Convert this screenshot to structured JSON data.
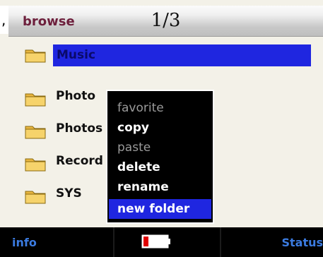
{
  "header": {
    "title": "browse",
    "page_indicator": "1/3",
    "stray_mark": ","
  },
  "folders": [
    {
      "label": "Music",
      "selected": true
    },
    {
      "label": "Photo",
      "selected": false
    },
    {
      "label": "Photos",
      "selected": false
    },
    {
      "label": "Record",
      "selected": false
    },
    {
      "label": "SYS",
      "selected": false
    }
  ],
  "context_menu": {
    "items": [
      {
        "label": "favorite",
        "enabled": false,
        "highlighted": false
      },
      {
        "label": "copy",
        "enabled": true,
        "highlighted": false
      },
      {
        "label": "paste",
        "enabled": false,
        "highlighted": false
      },
      {
        "label": "delete",
        "enabled": true,
        "highlighted": false
      },
      {
        "label": "rename",
        "enabled": true,
        "highlighted": false
      },
      {
        "label": "new folder",
        "enabled": true,
        "highlighted": true
      }
    ]
  },
  "softkeys": {
    "left": "info",
    "right": "Status"
  },
  "battery": {
    "level": 0.2,
    "color": "#e00000"
  },
  "colors": {
    "selection": "#1f26e0",
    "title": "#6d1f3c",
    "softkey": "#3b7be0"
  },
  "icons": {
    "folder": "folder-icon",
    "battery": "battery-icon"
  }
}
